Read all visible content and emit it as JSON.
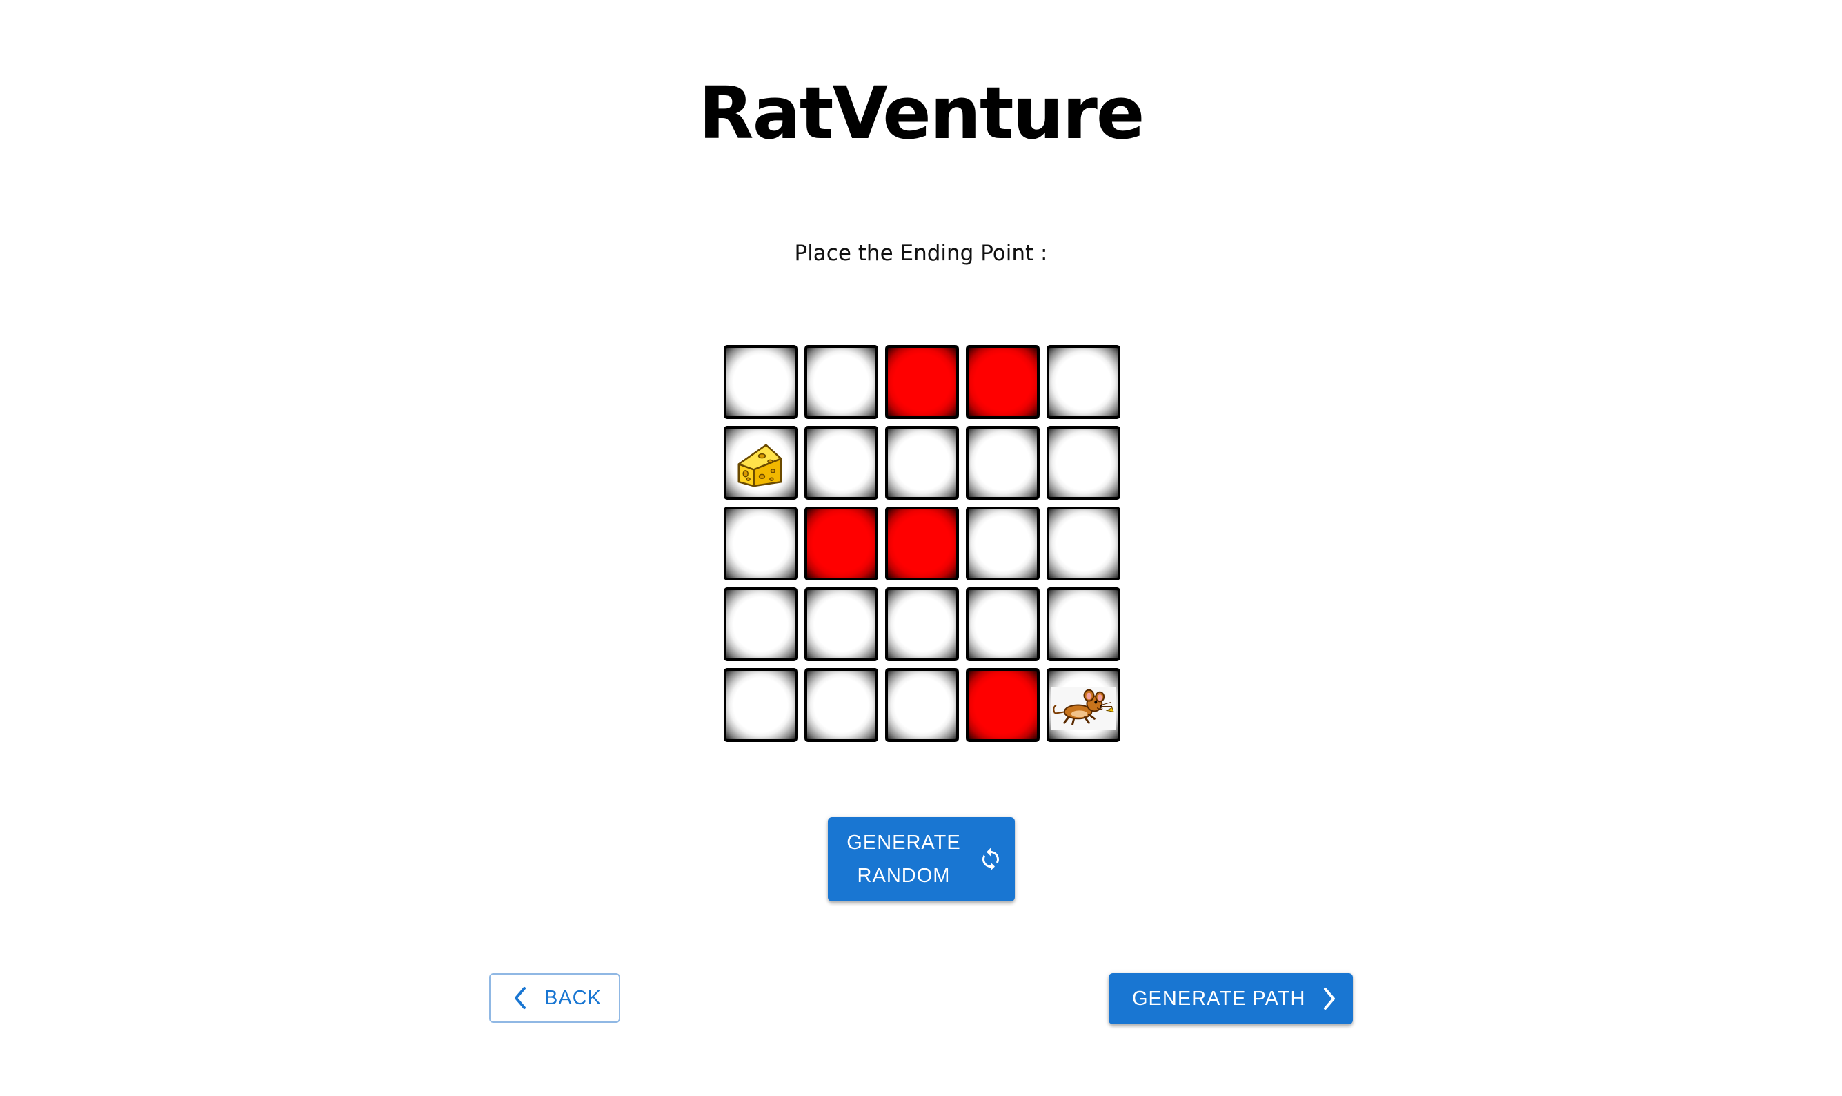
{
  "app": {
    "title": "RatVenture",
    "instruction": "Place the Ending Point :"
  },
  "maze": {
    "rows": 5,
    "cols": 5,
    "cells": [
      [
        "open",
        "open",
        "wall",
        "wall",
        "open"
      ],
      [
        "cheese",
        "open",
        "open",
        "open",
        "open"
      ],
      [
        "open",
        "wall",
        "wall",
        "open",
        "open"
      ],
      [
        "open",
        "open",
        "open",
        "open",
        "open"
      ],
      [
        "open",
        "open",
        "open",
        "wall",
        "rat"
      ]
    ],
    "colors": {
      "wall": "#ff0000",
      "open": "#ffffff",
      "border": "#000000"
    },
    "icons": {
      "cheese": "cheese-icon",
      "rat": "rat-icon"
    }
  },
  "buttons": {
    "generate_random": {
      "line1": "GENERATE",
      "line2": "RANDOM",
      "icon": "refresh-icon"
    },
    "back": {
      "label": "BACK",
      "icon": "chevron-left-icon"
    },
    "generate_path": {
      "label": "GENERATE PATH",
      "icon": "chevron-right-icon"
    }
  },
  "theme": {
    "primary": "#1976d2",
    "outline_border": "#90b8e4"
  }
}
